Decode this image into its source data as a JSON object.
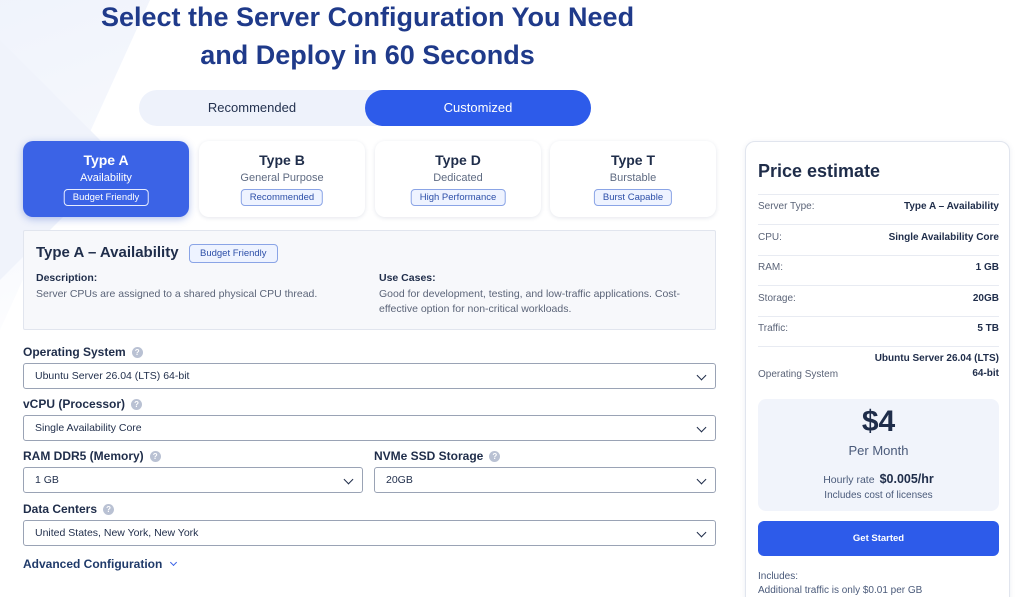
{
  "headline": {
    "line1": "Select the Server Configuration You Need",
    "line2": "and Deploy in 60 Seconds"
  },
  "mode_toggle": {
    "options": [
      "Recommended",
      "Customized"
    ],
    "selected": "Customized"
  },
  "server_types": [
    {
      "name": "Type A",
      "subtitle": "Availability",
      "badge": "Budget Friendly",
      "selected": true
    },
    {
      "name": "Type B",
      "subtitle": "General Purpose",
      "badge": "Recommended",
      "selected": false
    },
    {
      "name": "Type D",
      "subtitle": "Dedicated",
      "badge": "High Performance",
      "selected": false
    },
    {
      "name": "Type T",
      "subtitle": "Burstable",
      "badge": "Burst Capable",
      "selected": false
    }
  ],
  "details": {
    "title": "Type A – Availability",
    "badge": "Budget Friendly",
    "description_label": "Description:",
    "description": "Server CPUs are assigned to a shared physical CPU thread.",
    "use_cases_label": "Use Cases:",
    "use_cases_line1": "Good for development, testing, and low-traffic applications. Cost-",
    "use_cases_line2": "effective option for non-critical workloads."
  },
  "form": {
    "os": {
      "label": "Operating System",
      "value": "Ubuntu Server 26.04 (LTS) 64-bit"
    },
    "vcpu": {
      "label": "vCPU (Processor)",
      "value": "Single Availability Core"
    },
    "ram": {
      "label": "RAM DDR5 (Memory)",
      "value": "1 GB"
    },
    "storage": {
      "label": "NVMe SSD Storage",
      "value": "20GB"
    },
    "datacenter": {
      "label": "Data Centers",
      "value": "United States, New York, New York"
    },
    "advanced_label": "Advanced Configuration",
    "help_glyph": "?"
  },
  "price_estimate": {
    "title": "Price estimate",
    "rows": [
      {
        "label": "Server Type:",
        "value": "Type A – Availability"
      },
      {
        "label": "CPU:",
        "value": "Single Availability Core"
      },
      {
        "label": "RAM:",
        "value": "1 GB"
      },
      {
        "label": "Storage:",
        "value": "20GB"
      },
      {
        "label": "Traffic:",
        "value": "5 TB"
      }
    ],
    "os_label": "Operating System",
    "os_value_line1": "Ubuntu Server 26.04 (LTS)",
    "os_value_line2": "64-bit",
    "amount": "$4",
    "period": "Per Month",
    "hourly_label": "Hourly rate",
    "hourly_value": "$0.005/hr",
    "licenses_note": "Includes cost of licenses",
    "cta_label": "Get Started",
    "includes_label": "Includes:",
    "includes_line1": "Additional traffic is only $0.01 per GB"
  },
  "colors": {
    "accent": "#2d5bea",
    "heading": "#1f3a8a",
    "selected_card": "#3b63e6"
  }
}
